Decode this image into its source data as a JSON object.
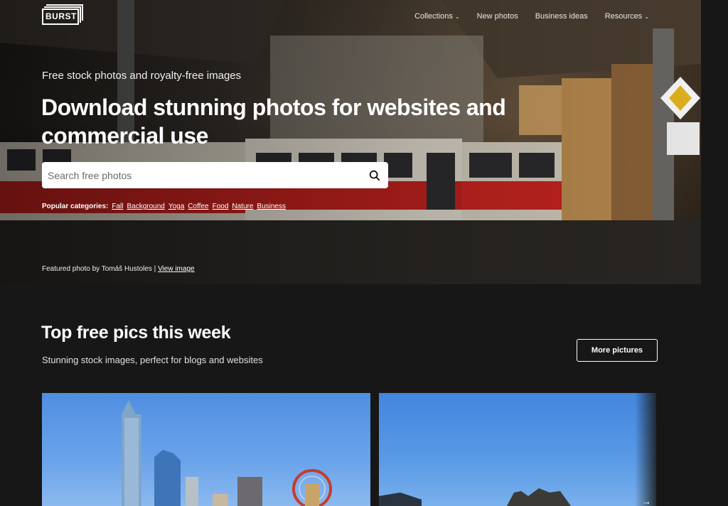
{
  "brand": {
    "logo_text": "BURST"
  },
  "nav": {
    "items": [
      {
        "label": "Collections",
        "dropdown": true
      },
      {
        "label": "New photos",
        "dropdown": false
      },
      {
        "label": "Business ideas",
        "dropdown": false
      },
      {
        "label": "Resources",
        "dropdown": true
      }
    ]
  },
  "hero": {
    "subtitle": "Free stock photos and royalty-free images",
    "headline": "Download stunning photos for websites and commercial use",
    "search": {
      "placeholder": "Search free photos"
    },
    "popular_label": "Popular categories:",
    "categories": [
      "Fall",
      "Background",
      "Yoga",
      "Coffee",
      "Food",
      "Nature",
      "Business"
    ],
    "credit_prefix": "Featured photo by Tomáš Hustoles |",
    "credit_link": "View image"
  },
  "section": {
    "title": "Top free pics this week",
    "subtitle": "Stunning stock images, perfect for blogs and websites",
    "more_button": "More pictures"
  },
  "carousel": {
    "next_icon": "arrow-right-icon"
  },
  "colors": {
    "background": "#171717",
    "tram_red": "#b8201c",
    "sky_blue": "#4f8fe0"
  }
}
